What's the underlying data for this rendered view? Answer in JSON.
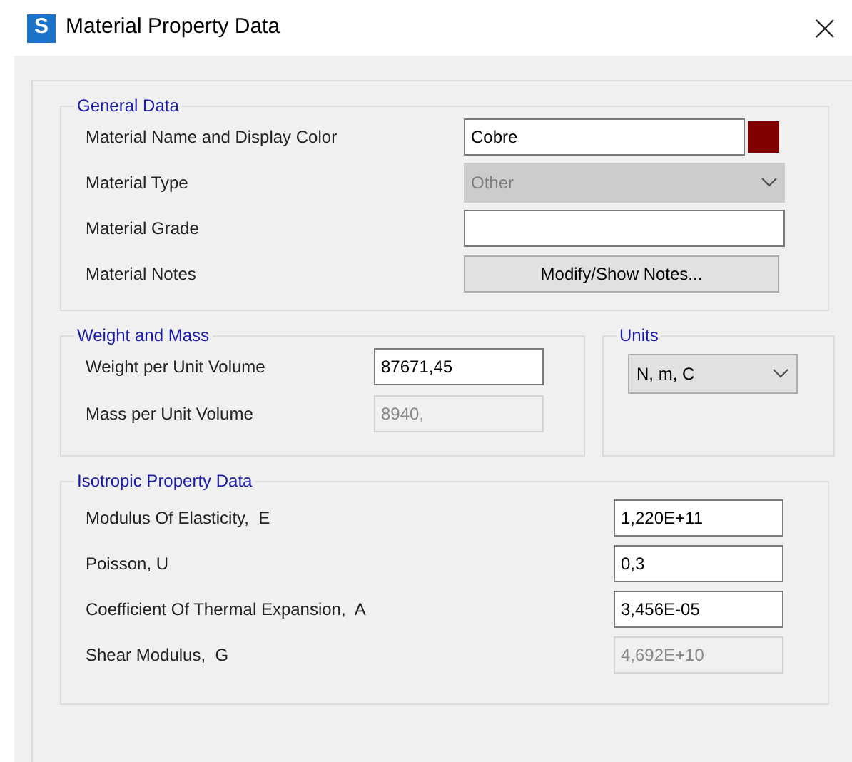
{
  "window": {
    "title": "Material Property Data",
    "app_icon": "S"
  },
  "general_data": {
    "title": "General Data",
    "rows": [
      {
        "label": "Material Name and Display Color",
        "kind": "text",
        "value": "Cobre",
        "disabled": false,
        "color": "#800000"
      },
      {
        "label": "Material Type",
        "kind": "dropdown",
        "value": "Other",
        "disabled": true
      },
      {
        "label": "Material Grade",
        "kind": "text",
        "disabled": false
      },
      {
        "label": "Material Notes",
        "kind": "button",
        "value": "Modify/Show Notes..."
      }
    ]
  },
  "weight_and_mass": {
    "title": "Weight and Mass",
    "rows": [
      {
        "label": "Weight per Unit Volume",
        "value": "87671,45",
        "disabled": false
      },
      {
        "label": "Mass per Unit Volume",
        "value": "8940,",
        "disabled": true
      }
    ]
  },
  "units": {
    "title": "Units",
    "value": "N, m, C"
  },
  "isotropic_property_data": {
    "title": "Isotropic Property Data",
    "rows": [
      {
        "label": "Modulus Of Elasticity,  E",
        "value": "1,220E+11",
        "disabled": false
      },
      {
        "label": "Poisson, U",
        "value": "0,3",
        "disabled": false
      },
      {
        "label": "Coefficient Of Thermal Expansion,  A",
        "value": "3,456E-05",
        "disabled": false
      },
      {
        "label": "Shear Modulus,  G",
        "value": "4,692E+10",
        "disabled": true
      }
    ]
  }
}
